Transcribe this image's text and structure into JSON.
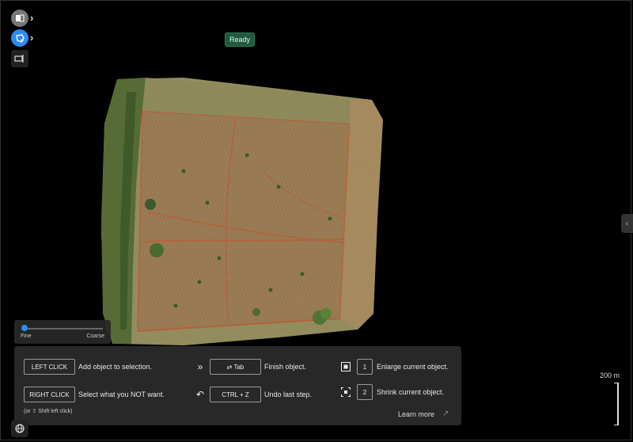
{
  "status": {
    "label": "Ready"
  },
  "toolbar": {
    "tools": [
      {
        "icon": "layers-icon"
      },
      {
        "icon": "magic-select-icon",
        "active": true
      },
      {
        "icon": "crop-tool-icon"
      }
    ]
  },
  "slider": {
    "min_label": "Fine",
    "max_label": "Coarse",
    "value": 0.0
  },
  "help": {
    "left_click_key": "LEFT CLICK",
    "left_click_desc": "Add object to selection.",
    "right_click_key": "RIGHT CLICK",
    "right_click_desc": "Select what you NOT want.",
    "right_click_hint": "(or ⇧ Shift left click)",
    "tab_key": "⇄ Tab",
    "tab_desc": "Finish object.",
    "undo_key": "CTRL + Z",
    "undo_desc": "Undo last step.",
    "enlarge_key": "1",
    "enlarge_desc": "Enlarge current object.",
    "shrink_key": "2",
    "shrink_desc": "Shrink current object.",
    "learn_more": "Learn more"
  },
  "scale": {
    "label": "200 m"
  },
  "colors": {
    "accent": "#2d8cf0",
    "status_bg": "#1f5a3c",
    "panel": "#2a2a2a"
  }
}
